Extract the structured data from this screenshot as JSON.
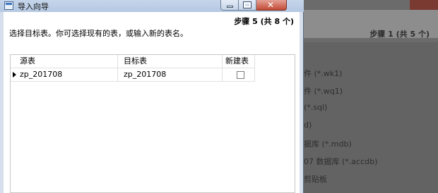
{
  "background_window": {
    "step_label": "步骤 1 (共 5 个)",
    "file_types": [
      "件 (*.wk1)",
      "件 (*.wq1)",
      "(*.sql)",
      "d)",
      "据库 (*.mdb)",
      "07 数据库 (*.accdb)",
      "剪贴板"
    ]
  },
  "dialog": {
    "title": "导入向导",
    "step_label": "步骤 5 (共 8 个)",
    "instruction": "选择目标表。你可选择现有的表，或输入新的表名。",
    "window_buttons": {
      "minimize": "minimize",
      "maximize": "maximize",
      "close": "close"
    },
    "grid": {
      "columns": [
        "源表",
        "目标表",
        "新建表"
      ],
      "rows": [
        {
          "source": "zp_201708",
          "target": "zp_201708",
          "new_table_checked": false
        }
      ]
    }
  }
}
